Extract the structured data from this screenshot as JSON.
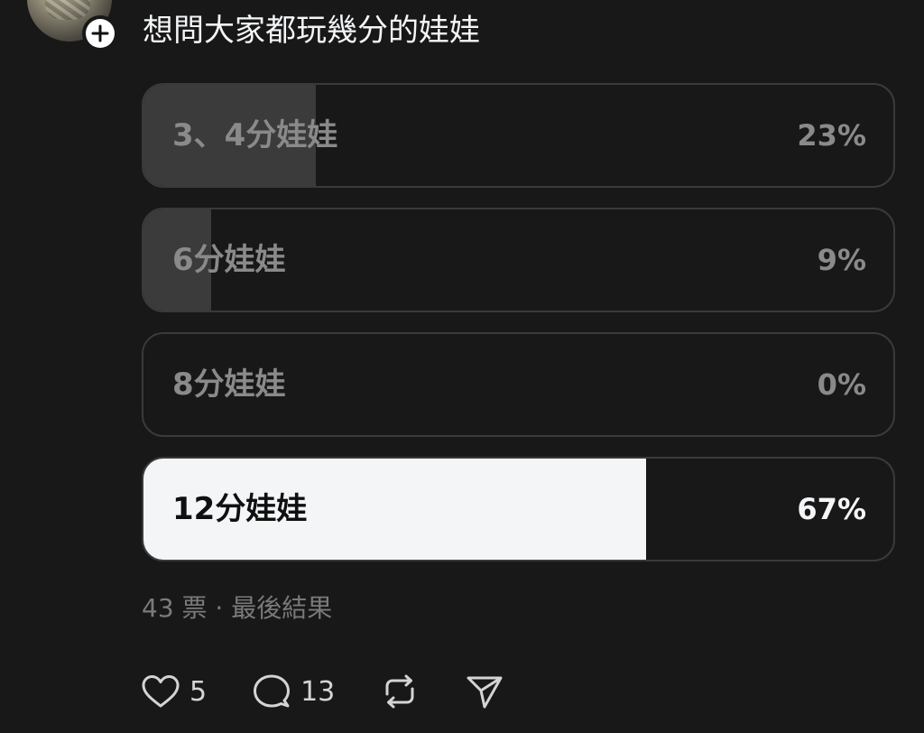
{
  "post": {
    "title": "想問大家都玩幾分的娃娃"
  },
  "poll": {
    "options": [
      {
        "label": "3、4分娃娃",
        "percent_text": "23%",
        "percent": 23,
        "winner": false
      },
      {
        "label": "6分娃娃",
        "percent_text": "9%",
        "percent": 9,
        "winner": false
      },
      {
        "label": "8分娃娃",
        "percent_text": "0%",
        "percent": 0,
        "winner": false
      },
      {
        "label": "12分娃娃",
        "percent_text": "67%",
        "percent": 67,
        "winner": true
      }
    ],
    "meta": "43 票 · 最後結果"
  },
  "actions": {
    "like_count": "5",
    "reply_count": "13",
    "icons": [
      "heart-icon",
      "comment-icon",
      "repost-icon",
      "share-icon"
    ]
  },
  "colors": {
    "background": "#181818",
    "winner_fill": "#f3f5f7",
    "option_fill": "#3b3b3b",
    "muted_text": "#8a8a8a"
  }
}
